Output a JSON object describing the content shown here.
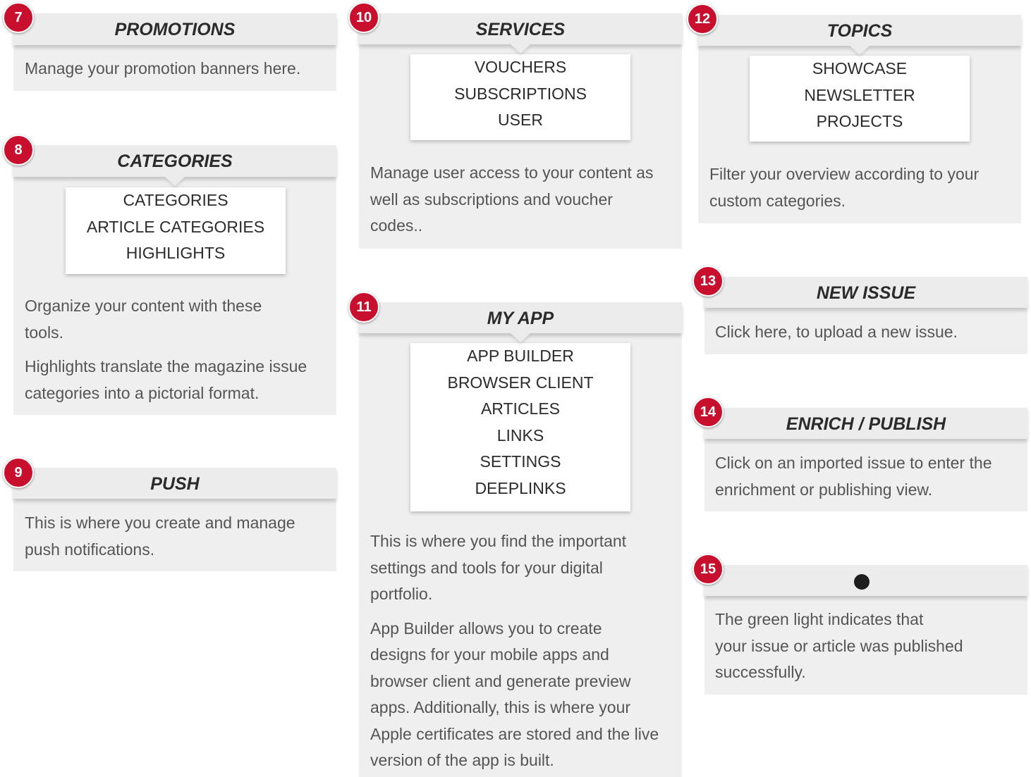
{
  "promotions": {
    "number": "7",
    "title": "PROMOTIONS",
    "description": "Manage your promotion banners here."
  },
  "categories": {
    "number": "8",
    "title": "CATEGORIES",
    "menu": [
      "CATEGORIES",
      "ARTICLE CATEGORIES",
      "HIGHLIGHTS"
    ],
    "description_1": "Organize your content with these tools.",
    "description_2": "Highlights translate the magazine issue categories into a pictorial format."
  },
  "push": {
    "number": "9",
    "title": "PUSH",
    "description": "This is where you create and manage push notifications."
  },
  "services": {
    "number": "10",
    "title": "SERVICES",
    "menu": [
      "VOUCHERS",
      "SUBSCRIPTIONS",
      "USER"
    ],
    "description": "Manage user access to your content as well as subscriptions and voucher codes.."
  },
  "my_app": {
    "number": "11",
    "title": "MY APP",
    "menu": [
      "APP BUILDER",
      "BROWSER CLIENT",
      "ARTICLES",
      "LINKS",
      "SETTINGS",
      "DEEPLINKS"
    ],
    "description_1": "This is where you find the important settings and tools for your digital portfolio.",
    "description_2": "App Builder allows you to create designs for your mobile apps and browser client and generate preview apps. Additionally, this is where your Apple certificates are stored and the live version of the app is built."
  },
  "topics": {
    "number": "12",
    "title": "TOPICS",
    "menu": [
      "SHOWCASE",
      "NEWSLETTER",
      "PROJECTS"
    ],
    "description": "Filter your overview according to your custom categories."
  },
  "new_issue": {
    "number": "13",
    "title": "NEW ISSUE",
    "description": "Click here, to upload a new issue."
  },
  "enrich_publish": {
    "number": "14",
    "title": "ENRICH / PUBLISH",
    "description": "Click on an imported issue to enter the enrichment or publishing view."
  },
  "status_light": {
    "number": "15",
    "icon": "status-dot-icon",
    "description_line_1": "The green light indicates that",
    "description_line_2": "your issue or article was published",
    "description_line_3": "successfully."
  },
  "colors": {
    "badge": "#c8102e",
    "card": "#efefef",
    "header": "#ececec",
    "text": "#555555"
  }
}
